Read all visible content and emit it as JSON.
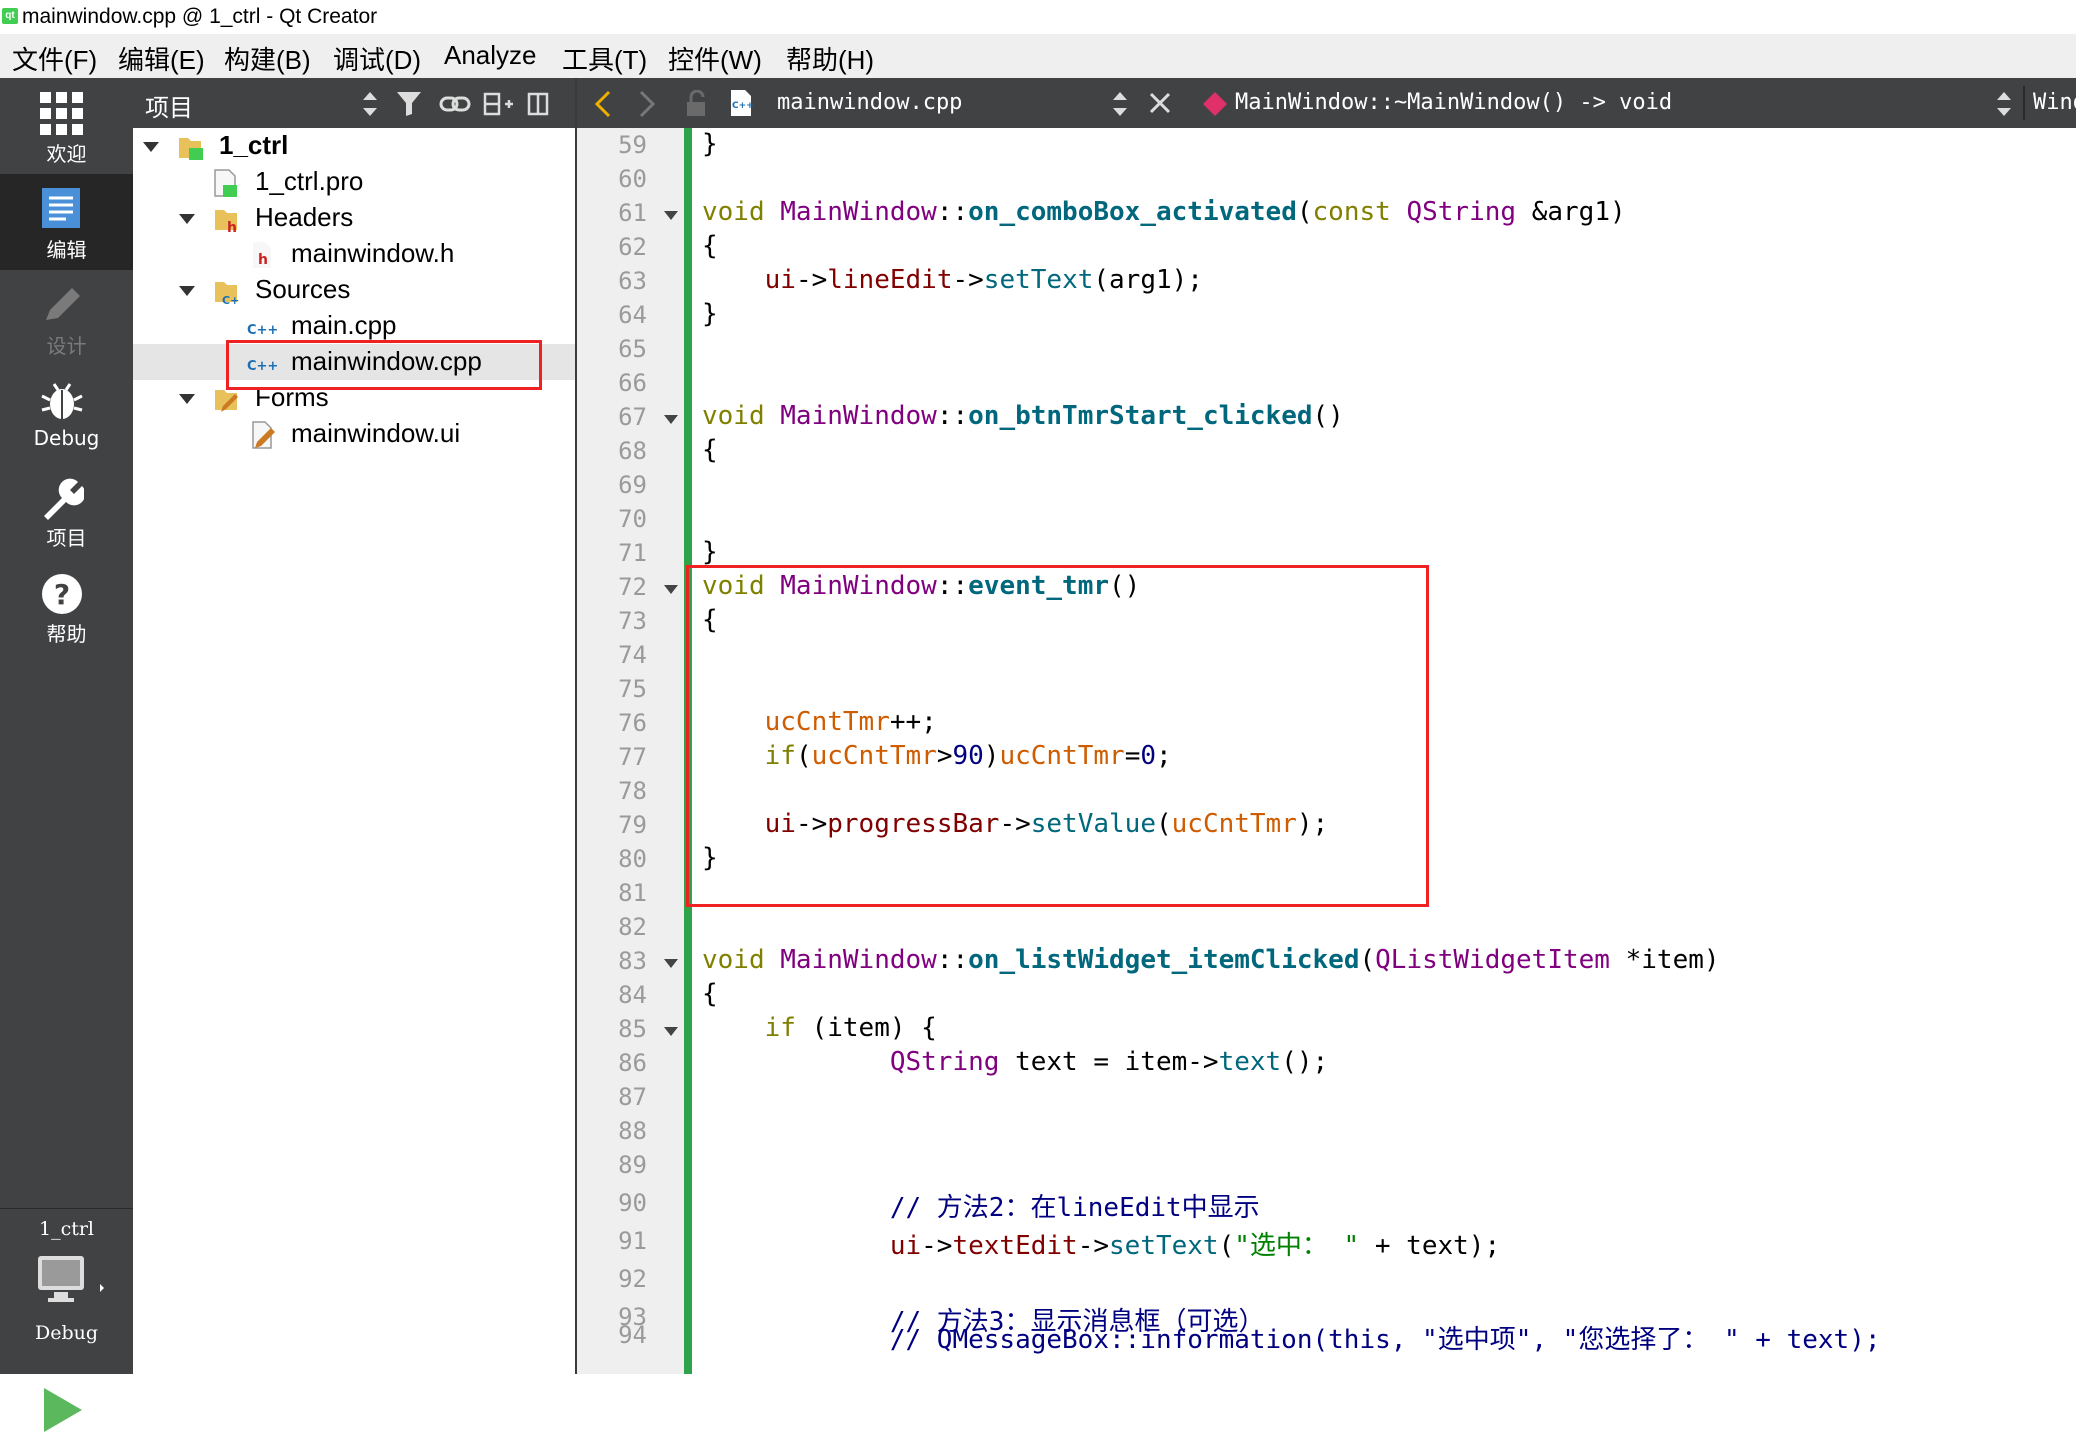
{
  "window": {
    "title": "mainwindow.cpp @ 1_ctrl - Qt Creator",
    "app_icon_text": "qt"
  },
  "menubar": [
    "文件(F)",
    "编辑(E)",
    "构建(B)",
    "调试(D)",
    "Analyze",
    "工具(T)",
    "控件(W)",
    "帮助(H)"
  ],
  "modes": [
    {
      "label": "欢迎",
      "icon": "grid-icon"
    },
    {
      "label": "编辑",
      "icon": "document-icon",
      "active": true
    },
    {
      "label": "设计",
      "icon": "pencil-icon",
      "disabled": true
    },
    {
      "label": "Debug",
      "icon": "bug-icon"
    },
    {
      "label": "项目",
      "icon": "wrench-icon"
    },
    {
      "label": "帮助",
      "icon": "help-icon"
    }
  ],
  "kit": {
    "project": "1_ctrl",
    "build": "Debug"
  },
  "project_panel": {
    "title": "项目",
    "tree": [
      {
        "label": "1_ctrl",
        "icon": "qt-project-folder-icon",
        "bold": true,
        "expanded": true
      },
      {
        "label": "1_ctrl.pro",
        "icon": "pro-file-icon"
      },
      {
        "label": "Headers",
        "icon": "header-folder-icon",
        "expanded": true
      },
      {
        "label": "mainwindow.h",
        "icon": "header-file-icon"
      },
      {
        "label": "Sources",
        "icon": "source-folder-icon",
        "expanded": true
      },
      {
        "label": "main.cpp",
        "icon": "cpp-file-icon"
      },
      {
        "label": "mainwindow.cpp",
        "icon": "cpp-file-icon",
        "selected": true
      },
      {
        "label": "Forms",
        "icon": "forms-folder-icon",
        "expanded": true
      },
      {
        "label": "mainwindow.ui",
        "icon": "ui-file-icon"
      }
    ]
  },
  "editor_toolbar": {
    "file": "mainwindow.cpp",
    "symbol": "MainWindow::~MainWindow() -> void",
    "right_cut": "Windo",
    "file_icon_text": "C++"
  },
  "editor": {
    "lines": [
      {
        "n": "59",
        "html": "}"
      },
      {
        "n": "60",
        "html": ""
      },
      {
        "n": "61",
        "fold": true,
        "html": "<span class=\"k\">void</span> <span class=\"ty\">MainWindow</span>::<span class=\"fn\">on_comboBox_activated</span>(<span class=\"k\">const</span> <span class=\"ty\">QString</span> &amp;arg1)"
      },
      {
        "n": "62",
        "html": "{"
      },
      {
        "n": "63",
        "html": "    <span class=\"fl\">ui</span>-&gt;<span class=\"fl\">lineEdit</span>-&gt;<span class=\"me\">setText</span>(arg1);"
      },
      {
        "n": "64",
        "html": "}"
      },
      {
        "n": "65",
        "html": ""
      },
      {
        "n": "66",
        "html": ""
      },
      {
        "n": "67",
        "fold": true,
        "html": "<span class=\"k\">void</span> <span class=\"ty\">MainWindow</span>::<span class=\"fn\">on_btnTmrStart_clicked</span>()"
      },
      {
        "n": "68",
        "html": "{"
      },
      {
        "n": "69",
        "html": ""
      },
      {
        "n": "70",
        "html": ""
      },
      {
        "n": "71",
        "html": "}"
      },
      {
        "n": "72",
        "fold": true,
        "html": "<span class=\"k\">void</span> <span class=\"ty\">MainWindow</span>::<span class=\"fn\">event_tmr</span>()"
      },
      {
        "n": "73",
        "html": "{"
      },
      {
        "n": "74",
        "html": ""
      },
      {
        "n": "75",
        "html": ""
      },
      {
        "n": "76",
        "html": "    <span class=\"va\">ucCntTmr</span>++;"
      },
      {
        "n": "77",
        "html": "    <span class=\"k\">if</span>(<span class=\"va\">ucCntTmr</span>&gt;<span class=\"nu\">90</span>)<span class=\"va\">ucCntTmr</span>=<span class=\"nu\">0</span>;"
      },
      {
        "n": "78",
        "html": ""
      },
      {
        "n": "79",
        "html": "    <span class=\"fl\">ui</span>-&gt;<span class=\"fl\">progressBar</span>-&gt;<span class=\"me\">setValue</span>(<span class=\"va\">ucCntTmr</span>);"
      },
      {
        "n": "80",
        "html": "}"
      },
      {
        "n": "81",
        "html": ""
      },
      {
        "n": "82",
        "html": ""
      },
      {
        "n": "83",
        "fold": true,
        "html": "<span class=\"k\">void</span> <span class=\"ty\">MainWindow</span>::<span class=\"fn\">on_listWidget_itemClicked</span>(<span class=\"ty\">QListWidgetItem</span> *item)"
      },
      {
        "n": "84",
        "html": "{"
      },
      {
        "n": "85",
        "fold": true,
        "html": "    <span class=\"k\">if</span> (item) {"
      },
      {
        "n": "86",
        "html": "            <span class=\"ty\">QString</span> text = item-&gt;<span class=\"me\">text</span>();"
      },
      {
        "n": "87",
        "html": ""
      },
      {
        "n": "88",
        "html": ""
      },
      {
        "n": "89",
        "html": ""
      },
      {
        "n": "90",
        "html": "            <span class=\"cm\">// 方法2：在lineEdit中显示</span>"
      },
      {
        "n": "91",
        "html": "            <span class=\"fl\">ui</span>-&gt;<span class=\"fl\">textEdit</span>-&gt;<span class=\"me\">setText</span>(<span class=\"st\">\"选中： \"</span> + text);"
      },
      {
        "n": "92",
        "html": ""
      },
      {
        "n": "93",
        "html": "            <span class=\"cm\">// 方法3：显示消息框（可选）</span>"
      },
      {
        "n": "94",
        "html": "            <span class=\"cm\">// QMessageBox::information(this, \"选中项\", \"您选择了： \" + text);</span>"
      }
    ]
  }
}
